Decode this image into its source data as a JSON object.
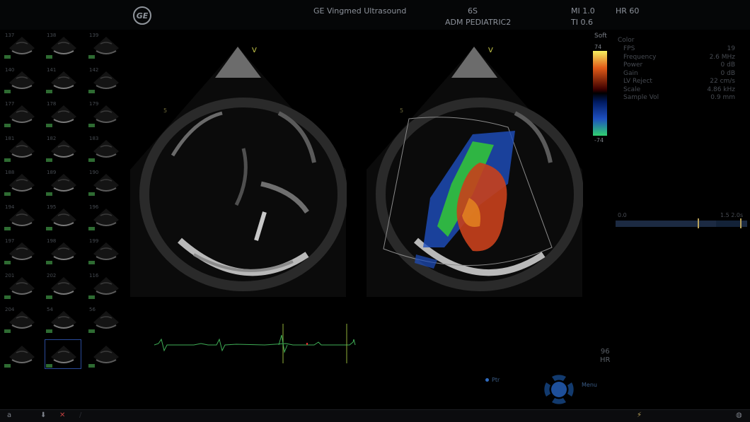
{
  "header": {
    "vendor": "GE Vingmed Ultrasound",
    "probe": "6S",
    "preset": "ADM PEDIATRIC2",
    "mi": "MI 1.0",
    "ti": "TI 0.6",
    "hr": "HR 60",
    "logo_text": "GE"
  },
  "thumbnails": [
    {
      "num": "137"
    },
    {
      "num": "138"
    },
    {
      "num": "139"
    },
    {
      "num": "140"
    },
    {
      "num": "141"
    },
    {
      "num": "142"
    },
    {
      "num": "177"
    },
    {
      "num": "178"
    },
    {
      "num": "179"
    },
    {
      "num": "181"
    },
    {
      "num": "182"
    },
    {
      "num": "183"
    },
    {
      "num": "188"
    },
    {
      "num": "189"
    },
    {
      "num": "190"
    },
    {
      "num": "194"
    },
    {
      "num": "195"
    },
    {
      "num": "196"
    },
    {
      "num": "197"
    },
    {
      "num": "198"
    },
    {
      "num": "199"
    },
    {
      "num": "201"
    },
    {
      "num": "202"
    },
    {
      "num": "116"
    },
    {
      "num": "204"
    },
    {
      "num": "54"
    },
    {
      "num": "56"
    },
    {
      "num": ""
    },
    {
      "num": ""
    },
    {
      "num": ""
    }
  ],
  "image_left": {
    "depth_marker": "5",
    "orientation_marker": "V"
  },
  "image_right": {
    "depth_marker": "5",
    "orientation_marker": "V"
  },
  "colorbar": {
    "filter": "Soft",
    "top": "74",
    "bottom": "-74"
  },
  "params": {
    "header": "Color",
    "rows": [
      {
        "label": "FPS",
        "value": "19"
      },
      {
        "label": "Frequency",
        "value": "2.6 MHz"
      },
      {
        "label": "Power",
        "value": "0 dB"
      },
      {
        "label": "Gain",
        "value": "0 dB"
      },
      {
        "label": "LV Reject",
        "value": "22 cm/s"
      },
      {
        "label": "Scale",
        "value": "4.86 kHz"
      },
      {
        "label": "Sample Vol",
        "value": "0.9 mm"
      }
    ]
  },
  "timeline": {
    "start": "0.0",
    "end": "1.5 2.0s"
  },
  "heart_rate": {
    "value": "96",
    "unit": "HR"
  },
  "controls": {
    "pointer": "Ptr",
    "menu": "Menu"
  },
  "bottom_bar": {
    "left_label": "a"
  },
  "colors": {
    "ecg": "#3fae56",
    "accent_blue": "#2f6bc0",
    "marker": "#b8a15a"
  }
}
